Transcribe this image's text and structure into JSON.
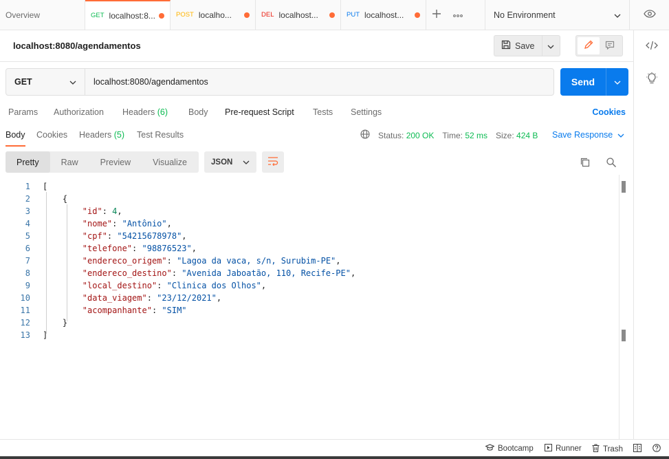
{
  "tabs": {
    "overview": "Overview",
    "items": [
      {
        "method": "GET",
        "label": "localhost:8...",
        "method_class": "m-get"
      },
      {
        "method": "POST",
        "label": "localho...",
        "method_class": "m-post"
      },
      {
        "method": "DEL",
        "label": "localhost...",
        "method_class": "m-del"
      },
      {
        "method": "PUT",
        "label": "localhost...",
        "method_class": "m-put"
      }
    ],
    "environment": "No Environment"
  },
  "request": {
    "title": "localhost:8080/agendamentos",
    "save_label": "Save",
    "method": "GET",
    "url": "localhost:8080/agendamentos",
    "send_label": "Send",
    "tabs": {
      "params": "Params",
      "authorization": "Authorization",
      "headers": "Headers",
      "headers_count": "(6)",
      "body": "Body",
      "pre_request": "Pre-request Script",
      "tests": "Tests",
      "settings": "Settings"
    },
    "cookies_link": "Cookies"
  },
  "response": {
    "tabs": {
      "body": "Body",
      "cookies": "Cookies",
      "headers": "Headers",
      "headers_count": "(5)",
      "test_results": "Test Results"
    },
    "status_label": "Status:",
    "status_value": "200 OK",
    "time_label": "Time:",
    "time_value": "52 ms",
    "size_label": "Size:",
    "size_value": "424 B",
    "save_response": "Save Response",
    "views": {
      "pretty": "Pretty",
      "raw": "Raw",
      "preview": "Preview",
      "visualize": "Visualize"
    },
    "format": "JSON",
    "lines": [
      {
        "n": "1",
        "open": "[",
        "key": "",
        "sep": "",
        "val": "",
        "end": "",
        "indent": ""
      },
      {
        "n": "2",
        "open": "{",
        "key": "",
        "sep": "",
        "val": "",
        "end": "",
        "indent": "    "
      },
      {
        "n": "3",
        "open": "",
        "key": "\"id\"",
        "sep": ": ",
        "val": "4",
        "end": ",",
        "indent": "        ",
        "num": true
      },
      {
        "n": "4",
        "open": "",
        "key": "\"nome\"",
        "sep": ": ",
        "val": "\"Antônio\"",
        "end": ",",
        "indent": "        "
      },
      {
        "n": "5",
        "open": "",
        "key": "\"cpf\"",
        "sep": ": ",
        "val": "\"54215678978\"",
        "end": ",",
        "indent": "        "
      },
      {
        "n": "6",
        "open": "",
        "key": "\"telefone\"",
        "sep": ": ",
        "val": "\"98876523\"",
        "end": ",",
        "indent": "        "
      },
      {
        "n": "7",
        "open": "",
        "key": "\"endereco_origem\"",
        "sep": ": ",
        "val": "\"Lagoa da vaca, s/n, Surubim-PE\"",
        "end": ",",
        "indent": "        "
      },
      {
        "n": "8",
        "open": "",
        "key": "\"endereco_destino\"",
        "sep": ": ",
        "val": "\"Avenida Jaboatão, 110, Recife-PE\"",
        "end": ",",
        "indent": "        "
      },
      {
        "n": "9",
        "open": "",
        "key": "\"local_destino\"",
        "sep": ": ",
        "val": "\"Clinica dos Olhos\"",
        "end": ",",
        "indent": "        "
      },
      {
        "n": "10",
        "open": "",
        "key": "\"data_viagem\"",
        "sep": ": ",
        "val": "\"23/12/2021\"",
        "end": ",",
        "indent": "        "
      },
      {
        "n": "11",
        "open": "",
        "key": "\"acompanhante\"",
        "sep": ": ",
        "val": "\"SIM\"",
        "end": "",
        "indent": "        "
      },
      {
        "n": "12",
        "open": "}",
        "key": "",
        "sep": "",
        "val": "",
        "end": "",
        "indent": "    "
      },
      {
        "n": "13",
        "open": "]",
        "key": "",
        "sep": "",
        "val": "",
        "end": "",
        "indent": ""
      }
    ]
  },
  "statusbar": {
    "bootcamp": "Bootcamp",
    "runner": "Runner",
    "trash": "Trash"
  },
  "colors": {
    "accent": "#ff6c37",
    "send": "#097bed",
    "success": "#0cbb52"
  }
}
